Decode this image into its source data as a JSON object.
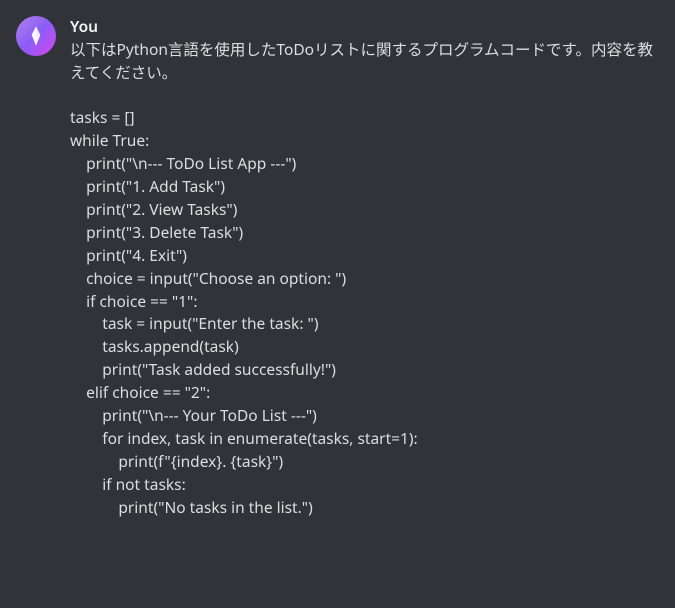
{
  "author": "You",
  "intro": "以下はPython言語を使用したToDoリストに関するプログラムコードです。内容を教えてください。",
  "code": {
    "l01": "tasks = []",
    "l02": "",
    "l03": "while True:",
    "l04": "    print(\"\\n--- ToDo List App ---\")",
    "l05": "    print(\"1. Add Task\")",
    "l06": "    print(\"2. View Tasks\")",
    "l07": "    print(\"3. Delete Task\")",
    "l08": "    print(\"4. Exit\")",
    "l09": "",
    "l10": "    choice = input(\"Choose an option: \")",
    "l11": "",
    "l12": "    if choice == \"1\":",
    "l13": "        task = input(\"Enter the task: \")",
    "l14": "        tasks.append(task)",
    "l15": "        print(\"Task added successfully!\")",
    "l16": "",
    "l17": "    elif choice == \"2\":",
    "l18": "        print(\"\\n--- Your ToDo List ---\")",
    "l19": "        for index, task in enumerate(tasks, start=1):",
    "l20": "            print(f\"{index}. {task}\")",
    "l21": "        if not tasks:",
    "l22": "            print(\"No tasks in the list.\")"
  }
}
